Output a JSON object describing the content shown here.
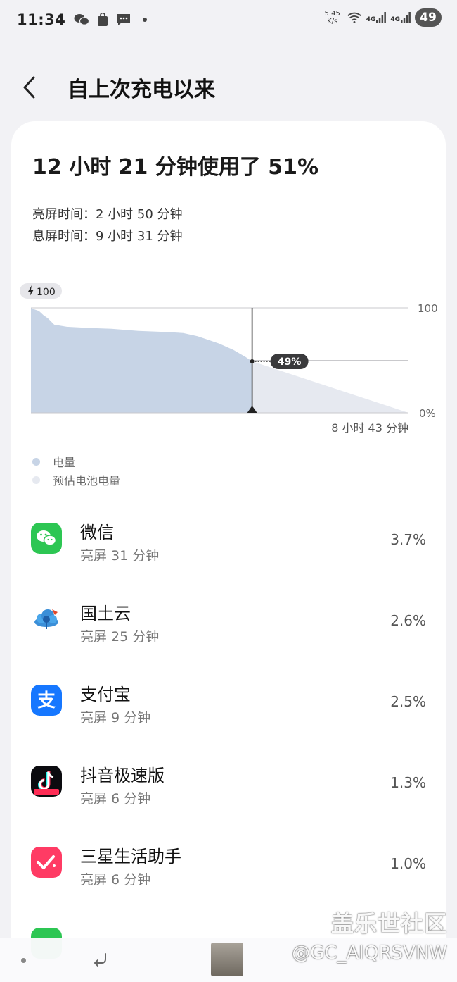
{
  "status_bar": {
    "time": "11:34",
    "icons": [
      "wechat-icon",
      "bag-icon",
      "message-icon",
      "dot-icon"
    ],
    "net_speed_value": "5.45",
    "net_speed_unit": "K/s",
    "signal1": "4G",
    "signal2": "4G",
    "battery": "49"
  },
  "header": {
    "back_icon": "chevron-left-icon",
    "title": "自上次充电以来"
  },
  "summary": {
    "usage": "12 小时 21 分钟使用了 51%",
    "screen_on": "亮屏时间：2 小时 50 分钟",
    "screen_off": "息屏时间：9 小时 31 分钟"
  },
  "chart_data": {
    "type": "area",
    "series": [
      {
        "name": "电量",
        "x_hours": [
          0,
          0.12,
          0.45,
          0.7,
          0.95,
          1.3,
          2.0,
          3.0,
          4.5,
          6.0,
          7.5,
          8.5,
          9.3,
          10.0,
          10.5,
          11.3,
          12.0,
          12.35
        ],
        "values": [
          100,
          99,
          97,
          93,
          90,
          84,
          82,
          81,
          80,
          78,
          77,
          76,
          73,
          69,
          66,
          60,
          53,
          49
        ]
      },
      {
        "name": "预估电池电量",
        "x_hours": [
          12.35,
          21.08
        ],
        "values": [
          49,
          0
        ]
      }
    ],
    "charge_badge": "100",
    "y_max_label": "100",
    "y_min_label": "0%",
    "current_label": "49%",
    "remaining_label": "8 小时 43 分钟",
    "xlim_hours": [
      0,
      21.08
    ],
    "ylim": [
      0,
      100
    ],
    "colors": {
      "battery": "#c7d4e6",
      "estimate": "#e6e9f0",
      "line": "#222222",
      "grid": "#c9c9cc"
    }
  },
  "legend": [
    {
      "label": "电量",
      "color": "#c7d4e6"
    },
    {
      "label": "预估电池电量",
      "color": "#e6e9f0"
    }
  ],
  "apps": [
    {
      "name": "微信",
      "sub": "亮屏 31 分钟",
      "pct": "3.7%",
      "icon": "wechat-icon"
    },
    {
      "name": "国土云",
      "sub": "亮屏 25 分钟",
      "pct": "2.6%",
      "icon": "cloud-icon"
    },
    {
      "name": "支付宝",
      "sub": "亮屏 9 分钟",
      "pct": "2.5%",
      "icon": "alipay-icon"
    },
    {
      "name": "抖音极速版",
      "sub": "亮屏 6 分钟",
      "pct": "1.3%",
      "icon": "douyin-icon"
    },
    {
      "name": "三星生活助手",
      "sub": "亮屏 6 分钟",
      "pct": "1.0%",
      "icon": "checkmark-icon"
    }
  ],
  "watermark": {
    "site": "盖乐世社区",
    "user": "@GC_AIQRSVNW"
  }
}
